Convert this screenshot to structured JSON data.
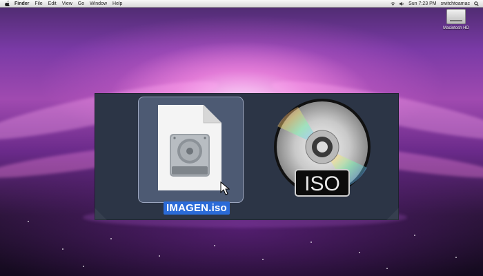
{
  "menubar": {
    "app_name": "Finder",
    "menus": [
      "File",
      "Edit",
      "View",
      "Go",
      "Window",
      "Help"
    ],
    "clock": "Sun 7:23 PM",
    "user": "switchtoamac",
    "icons": [
      "wifi-icon",
      "volume-icon",
      "spotlight-icon"
    ]
  },
  "desktop": {
    "hd_label": "Macintosh HD"
  },
  "panel": {
    "file_name": "IMAGEN.iso",
    "iso_label": "ISO"
  },
  "colors": {
    "selection": "#2b6bd8",
    "panel_bg": "#2c3546"
  }
}
